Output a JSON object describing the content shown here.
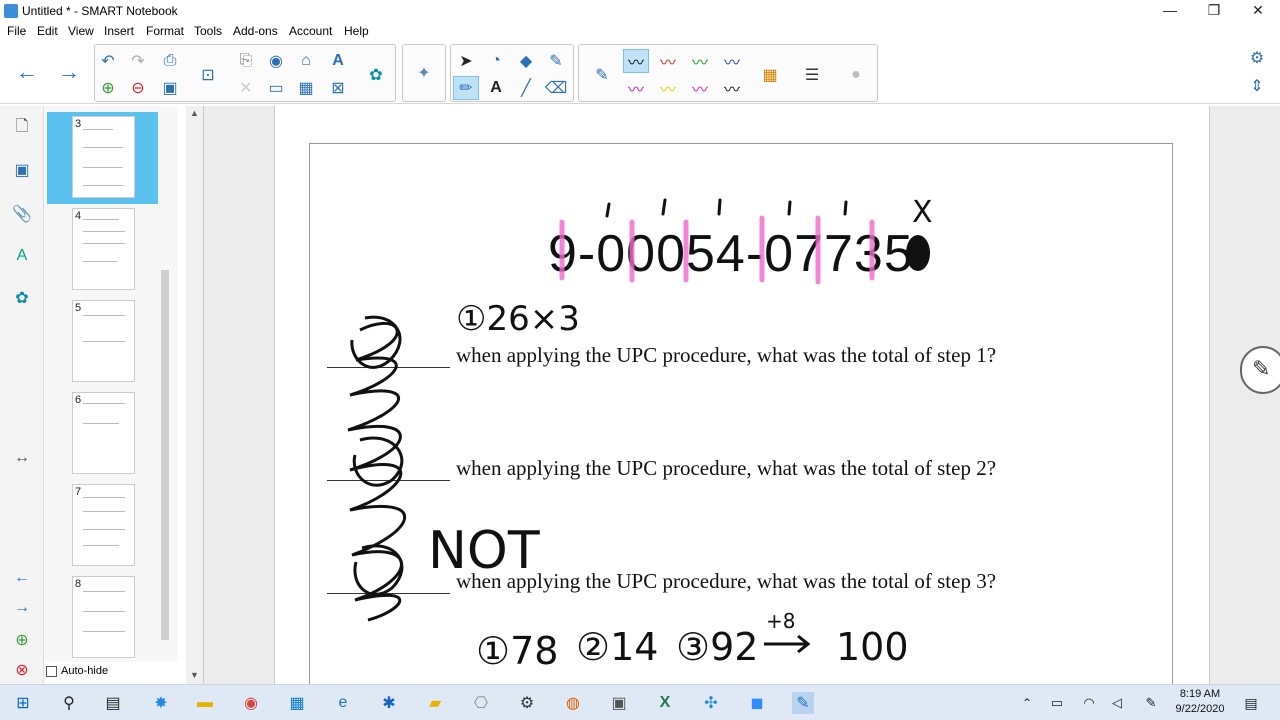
{
  "window": {
    "title": "Untitled * - SMART Notebook",
    "minimize": "—",
    "maximize": "❐",
    "close": "✕"
  },
  "menu": [
    "File",
    "Edit",
    "View",
    "Insert",
    "Format",
    "Tools",
    "Add-ons",
    "Account",
    "Help"
  ],
  "sorter": {
    "thumbs": [
      {
        "num": "3"
      },
      {
        "num": "4"
      },
      {
        "num": "5"
      },
      {
        "num": "6"
      },
      {
        "num": "7"
      },
      {
        "num": "8"
      }
    ],
    "autohide_label": "Auto-hide"
  },
  "slide": {
    "upc_code": "9-00054-07735-",
    "questions": [
      "when applying the UPC procedure, what was the total of step 1?",
      "when applying the UPC procedure, what was the total of step 2?",
      "when applying the UPC procedure, what was the total of step 3?"
    ],
    "handwriting": {
      "top_note": "①26×3",
      "not_note": "NOT",
      "x_mark": "X",
      "bottom_notes": [
        "①78",
        "②14",
        "③92",
        "+8",
        "100"
      ]
    }
  },
  "taskbar": {
    "time": "8:19 AM",
    "date": "9/22/2020"
  },
  "colors": {
    "accent": "#1e73c8",
    "selected_thumb": "#5bc1ee",
    "pink_highlight": "#f06acb"
  }
}
